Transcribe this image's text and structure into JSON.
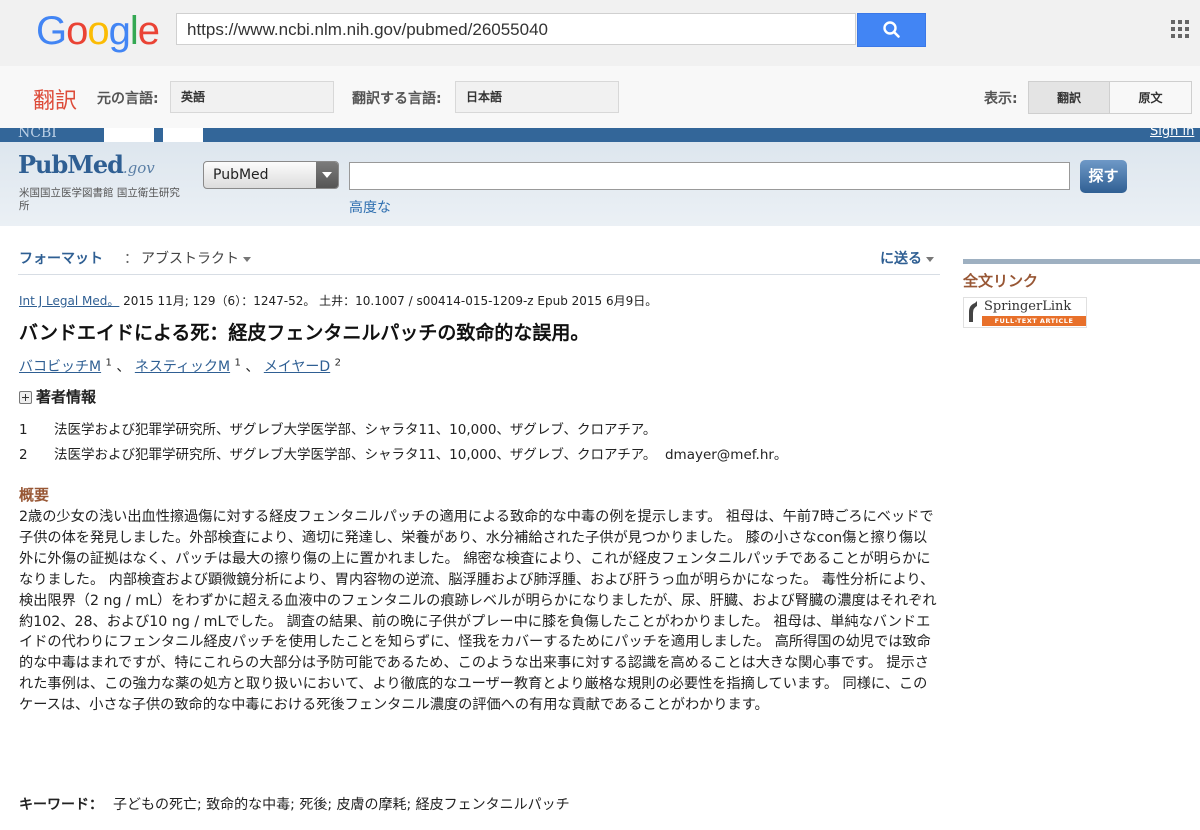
{
  "google": {
    "logo_letters": [
      "G",
      "o",
      "o",
      "g",
      "l",
      "e"
    ],
    "logo_colors": [
      "#4285f4",
      "#ea4335",
      "#fbbc05",
      "#4285f4",
      "#34a853",
      "#ea4335"
    ],
    "url": "https://www.ncbi.nlm.nih.gov/pubmed/26055040"
  },
  "translate": {
    "title": "翻訳",
    "source_label": "元の言語:",
    "source_value": "英語",
    "target_label": "翻訳する言語:",
    "target_value": "日本語",
    "view_label": "表示:",
    "view_translated": "翻訳",
    "view_original": "原文"
  },
  "ncbi": {
    "logo": "NCBI",
    "sign_in": "Sign in"
  },
  "pubmed": {
    "logo_main": "PubMed",
    "logo_gov": ".gov",
    "subtitle": "米国国立医学図書館 国立衛生研究所",
    "db_value": "PubMed",
    "search_value": "",
    "advanced": "高度な",
    "search_button": "探す"
  },
  "display": {
    "format_label": "フォーマット",
    "format_sep": "：",
    "format_value": "アブストラクト",
    "send_to": "に送る"
  },
  "sidebar": {
    "full_text_title": "全文リンク",
    "springer_name": "SpringerLink",
    "springer_band": "FULL-TEXT ARTICLE"
  },
  "article": {
    "journal": "Int J Legal Med。",
    "citation_rest": " 2015 11月; 129（6）：1247-52。 土井：10.1007 / s00414-015-1209-z Epub 2015 6月9日。",
    "title": "バンドエイドによる死：経皮フェンタニルパッチの致命的な誤用。",
    "authors": [
      {
        "name": "バコビッチM",
        "aff": "1",
        "sep": " 、 "
      },
      {
        "name": "ネスティックM",
        "aff": "1",
        "sep": " 、 "
      },
      {
        "name": "メイヤーD",
        "aff": "2",
        "sep": ""
      }
    ],
    "author_info_label": "著者情報",
    "affiliations": [
      {
        "num": "1",
        "text": "法医学および犯罪学研究所、ザグレブ大学医学部、シャラタ11、10,000、ザグレブ、クロアチア。"
      },
      {
        "num": "2",
        "text": "法医学および犯罪学研究所、ザグレブ大学医学部、シャラタ11、10,000、ザグレブ、クロアチア。  dmayer@mef.hr。"
      }
    ],
    "abstract_heading": "概要",
    "abstract": "2歳の少女の浅い出血性擦過傷に対する経皮フェンタニルパッチの適用による致命的な中毒の例を提示します。 祖母は、午前7時ごろにベッドで子供の体を発見しました。外部検査により、適切に発達し、栄養があり、水分補給された子供が見つかりました。 膝の小さなcon傷と擦り傷以外に外傷の証拠はなく、パッチは最大の擦り傷の上に置かれました。 綿密な検査により、これが経皮フェンタニルパッチであることが明らかになりました。 内部検査および顕微鏡分析により、胃内容物の逆流、脳浮腫および肺浮腫、および肝うっ血が明らかになった。 毒性分析により、検出限界（2 ng / mL）をわずかに超える血液中のフェンタニルの痕跡レベルが明らかになりましたが、尿、肝臓、および腎臓の濃度はそれぞれ約102、28、および10 ng / mLでした。 調査の結果、前の晩に子供がプレー中に膝を負傷したことがわかりました。 祖母は、単純なバンドエイドの代わりにフェンタニル経皮パッチを使用したことを知らずに、怪我をカバーするためにパッチを適用しました。 高所得国の幼児では致命的な中毒はまれですが、特にこれらの大部分は予防可能であるため、このような出来事に対する認識を高めることは大きな関心事です。 提示された事例は、この強力な薬の処方と取り扱いにおいて、より徹底的なユーザー教育とより厳格な規則の必要性を指摘しています。 同様に、このケースは、小さな子供の致命的な中毒における死後フェンタニル濃度の評価への有用な貢献であることがわかります。",
    "keywords_label": "キーワード：",
    "keywords": "子どもの死亡; 致命的な中毒; 死後; 皮膚の摩耗; 経皮フェンタニルパッチ"
  },
  "colors": {
    "google_blue": "#4285f4",
    "translate_red": "#dd4b39",
    "ncbi_blue": "#336699",
    "pubmed_link": "#2f5f93",
    "section_brown": "#985735",
    "springer_orange": "#e8702a"
  }
}
